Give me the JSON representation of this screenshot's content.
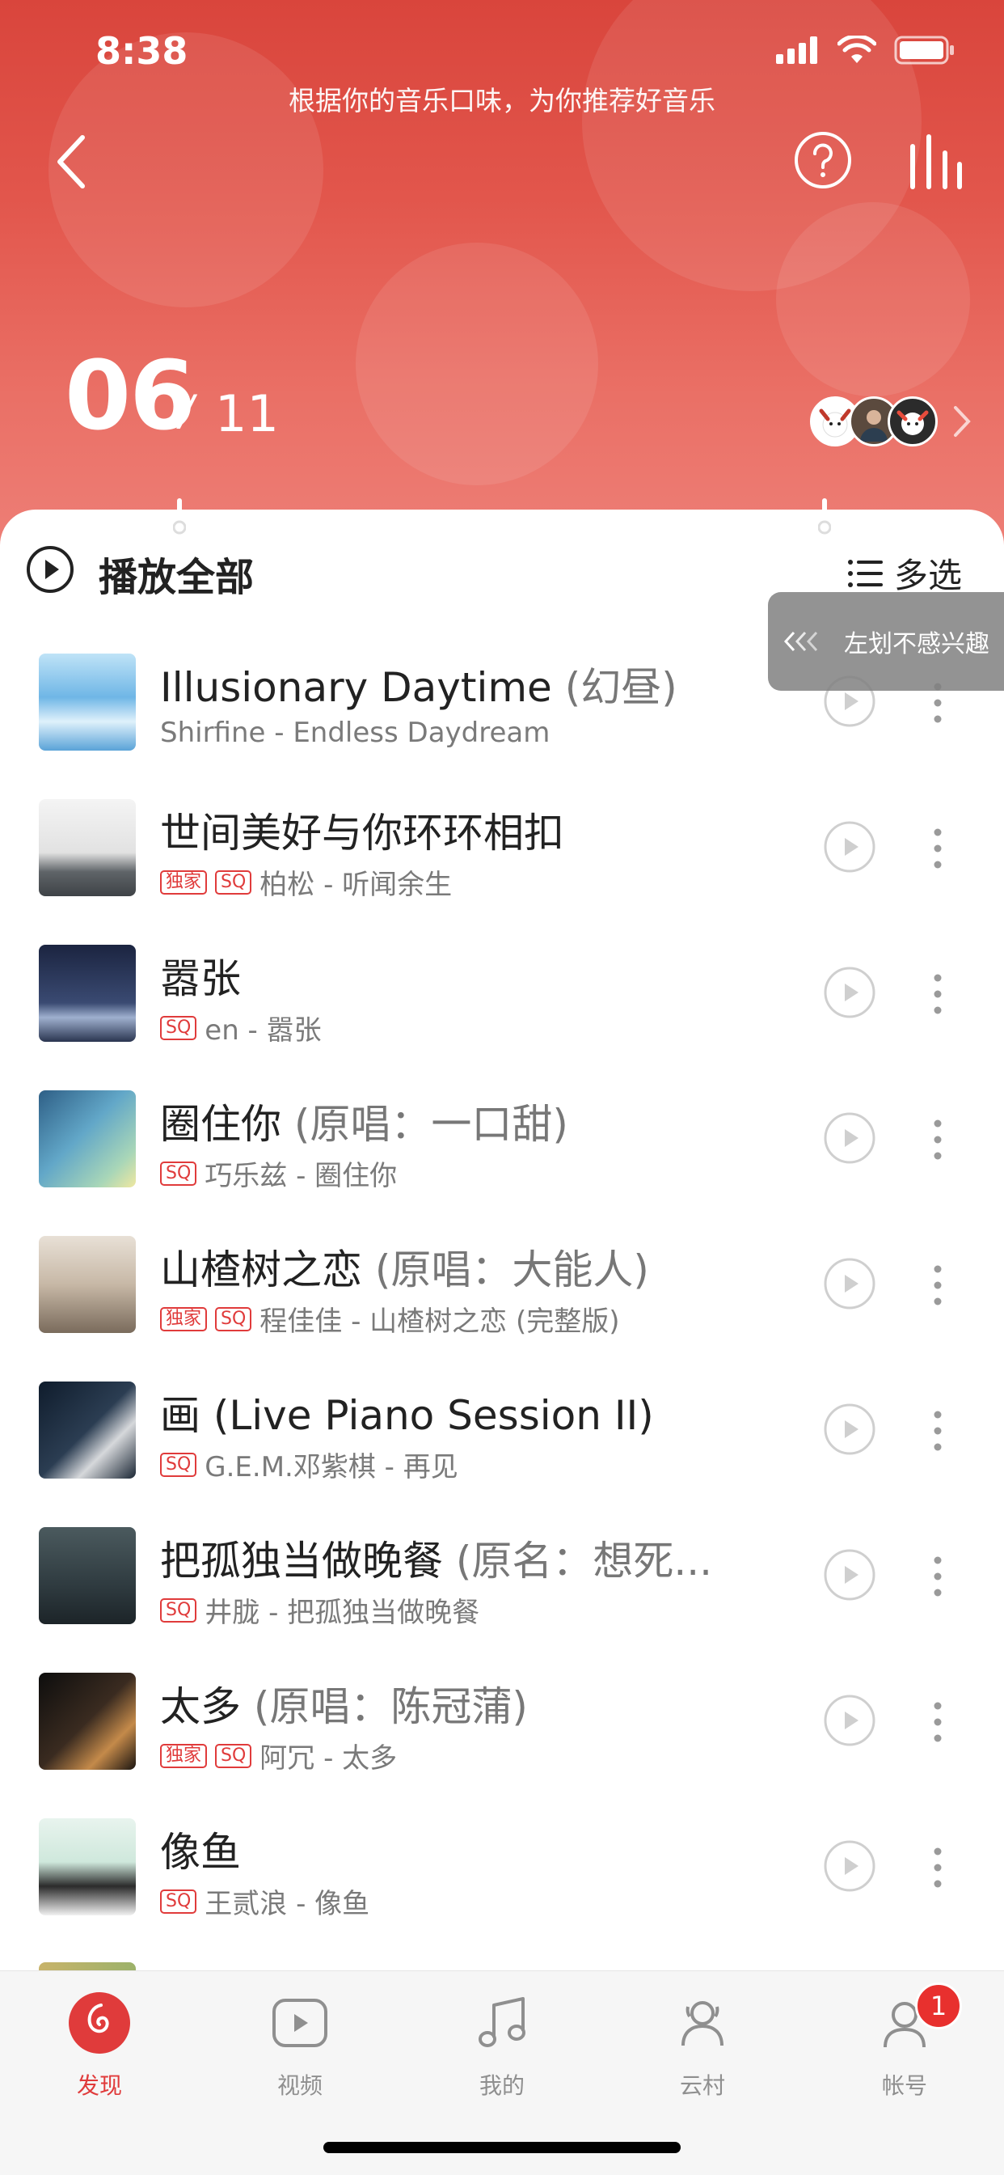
{
  "status_bar": {
    "time": "8:38"
  },
  "header": {
    "subtitle": "根据你的音乐口味，为你推荐好音乐",
    "date_day": "06",
    "date_sep": "/",
    "date_total": "11"
  },
  "toolbar": {
    "play_all_label": "播放全部",
    "multi_select_label": "多选"
  },
  "swipe_hint": "左划不感兴趣",
  "songs": [
    {
      "title": "Illusionary Daytime",
      "extra": " (幻昼)",
      "badges": [],
      "artist": "Shirfine - Endless Daydream"
    },
    {
      "title": "世间美好与你环环相扣",
      "extra": "",
      "badges": [
        "独家",
        "SQ"
      ],
      "artist": "柏松 - 听闻余生"
    },
    {
      "title": "嚣张",
      "extra": "",
      "badges": [
        "SQ"
      ],
      "artist": "en - 嚣张"
    },
    {
      "title": "圈住你",
      "extra": " (原唱：一口甜)",
      "badges": [
        "SQ"
      ],
      "artist": "巧乐兹 - 圈住你"
    },
    {
      "title": "山楂树之恋",
      "extra": " (原唱：大能人)",
      "badges": [
        "独家",
        "SQ"
      ],
      "artist": "程佳佳 - 山楂树之恋 (完整版)"
    },
    {
      "title": "画 (Live Piano Session II)",
      "extra": "",
      "badges": [
        "SQ"
      ],
      "artist": "G.E.M.邓紫棋 - 再见"
    },
    {
      "title": "把孤独当做晚餐",
      "extra": " (原名：想死...",
      "badges": [
        "SQ"
      ],
      "artist": "井胧 - 把孤独当做晚餐"
    },
    {
      "title": "太多",
      "extra": " (原唱：陈冠蒲)",
      "badges": [
        "独家",
        "SQ"
      ],
      "artist": "阿冗 - 太多"
    },
    {
      "title": "像鱼",
      "extra": "",
      "badges": [
        "SQ"
      ],
      "artist": "王贰浪 - 像鱼"
    }
  ],
  "tabbar": {
    "tabs": [
      {
        "label": "发现",
        "icon": "discover-icon",
        "active": true
      },
      {
        "label": "视频",
        "icon": "video-icon",
        "active": false
      },
      {
        "label": "我的",
        "icon": "music-note-icon",
        "active": false
      },
      {
        "label": "云村",
        "icon": "community-icon",
        "active": false
      },
      {
        "label": "帐号",
        "icon": "account-icon",
        "active": false,
        "badge": "1"
      }
    ]
  },
  "colors": {
    "accent": "#e03b3b",
    "header_top": "#d9453c",
    "header_bottom": "#ee8078"
  }
}
